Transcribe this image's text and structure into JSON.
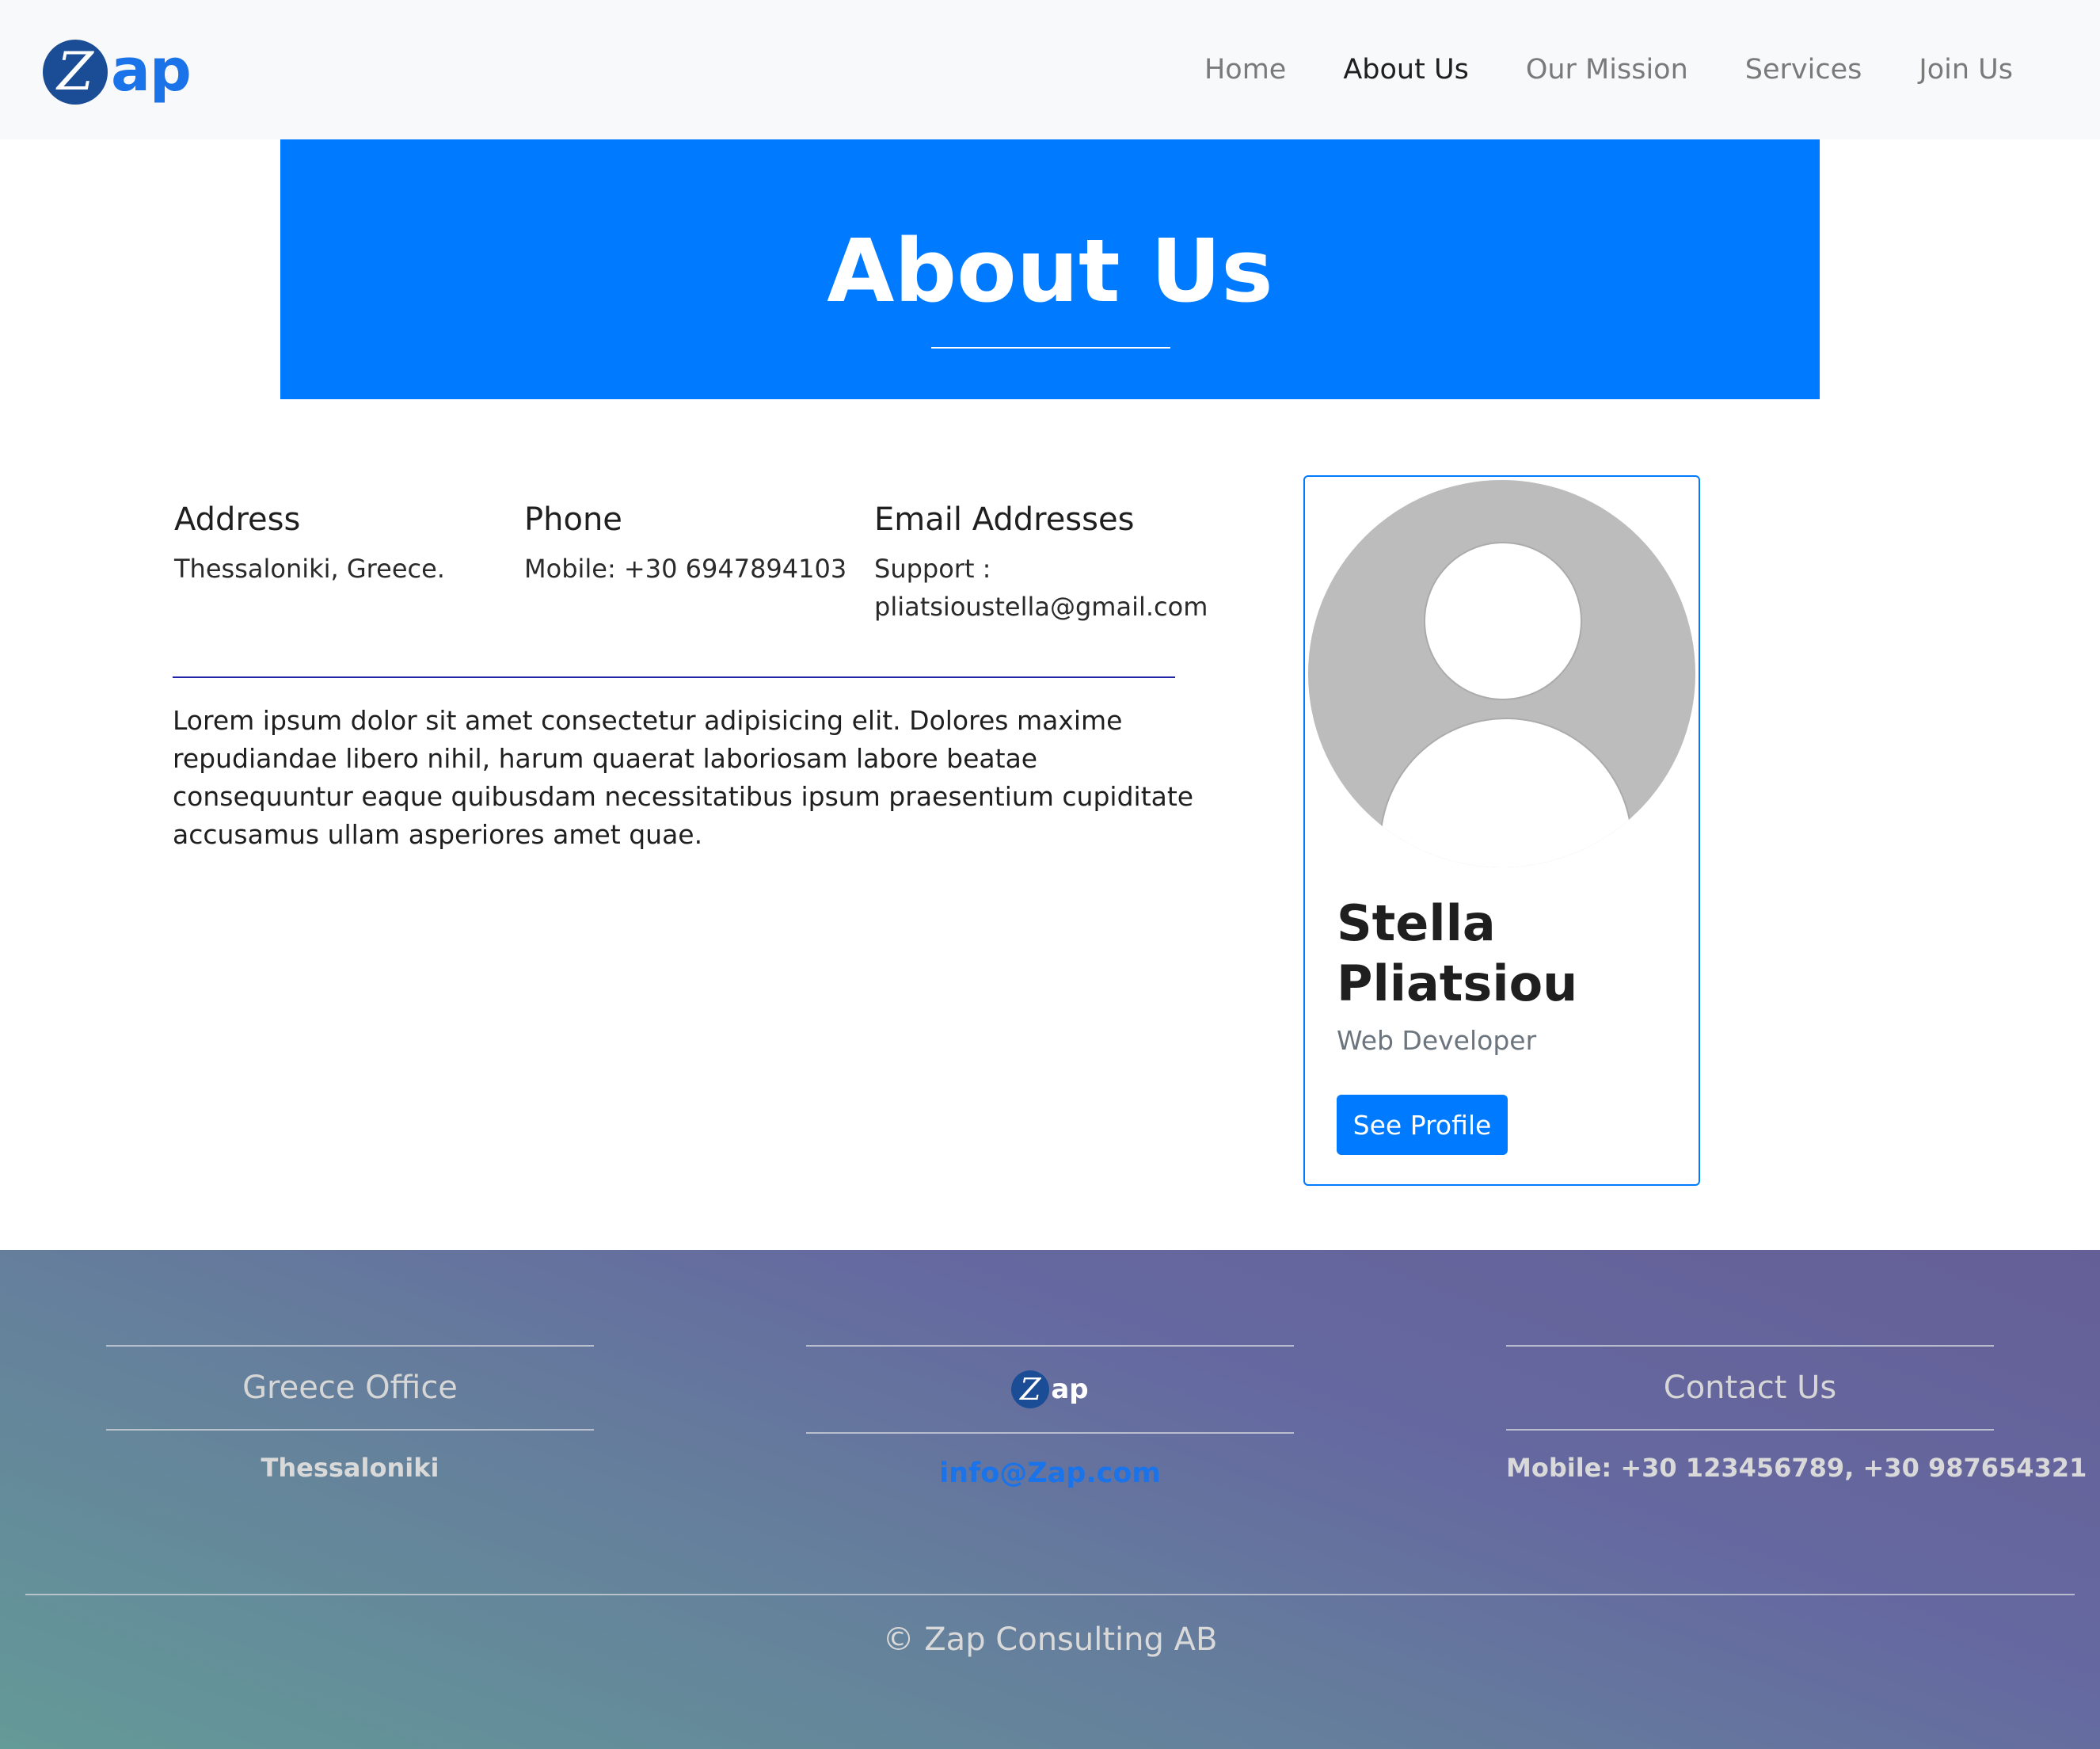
{
  "brand": {
    "z_letter": "Z",
    "rest": "ap"
  },
  "nav": {
    "items": [
      {
        "label": "Home",
        "active": false
      },
      {
        "label": "About Us",
        "active": true
      },
      {
        "label": "Our Mission",
        "active": false
      },
      {
        "label": "Services",
        "active": false
      },
      {
        "label": "Join Us",
        "active": false
      }
    ]
  },
  "hero": {
    "title": "About Us"
  },
  "contact_info": {
    "address": {
      "heading": "Address",
      "text": "Thessaloniki, Greece."
    },
    "phone": {
      "heading": "Phone",
      "text": "Mobile: +30 6947894103"
    },
    "email": {
      "heading": "Email Addresses",
      "line1": "Support :",
      "line2": "pliatsioustella@gmail.com"
    }
  },
  "about_text": "Lorem ipsum dolor sit amet consectetur adipisicing elit. Dolores maxime repudiandae libero nihil, harum quaerat laboriosam labore beatae consequuntur eaque quibusdam necessitatibus ipsum praesentium cupiditate accusamus ullam asperiores amet quae.",
  "profile_card": {
    "avatar_icon": "user-placeholder-icon",
    "name": "Stella Pliatsiou",
    "role": "Web Developer",
    "button_label": "See Profile"
  },
  "footer": {
    "office": {
      "title": "Greece Office",
      "city": "Thessaloniki"
    },
    "brand": {
      "z_letter": "Z",
      "rest": "ap",
      "email": "info@Zap.com"
    },
    "contact": {
      "title": "Contact Us",
      "mobile": "Mobile: +30 123456789, +30 987654321"
    },
    "copyright": "© Zap Consulting AB"
  },
  "colors": {
    "primary": "#007bff",
    "brand_circle": "#1b4d96",
    "brand_text": "#1a73e8",
    "navbar_bg": "#f8f9fa"
  }
}
